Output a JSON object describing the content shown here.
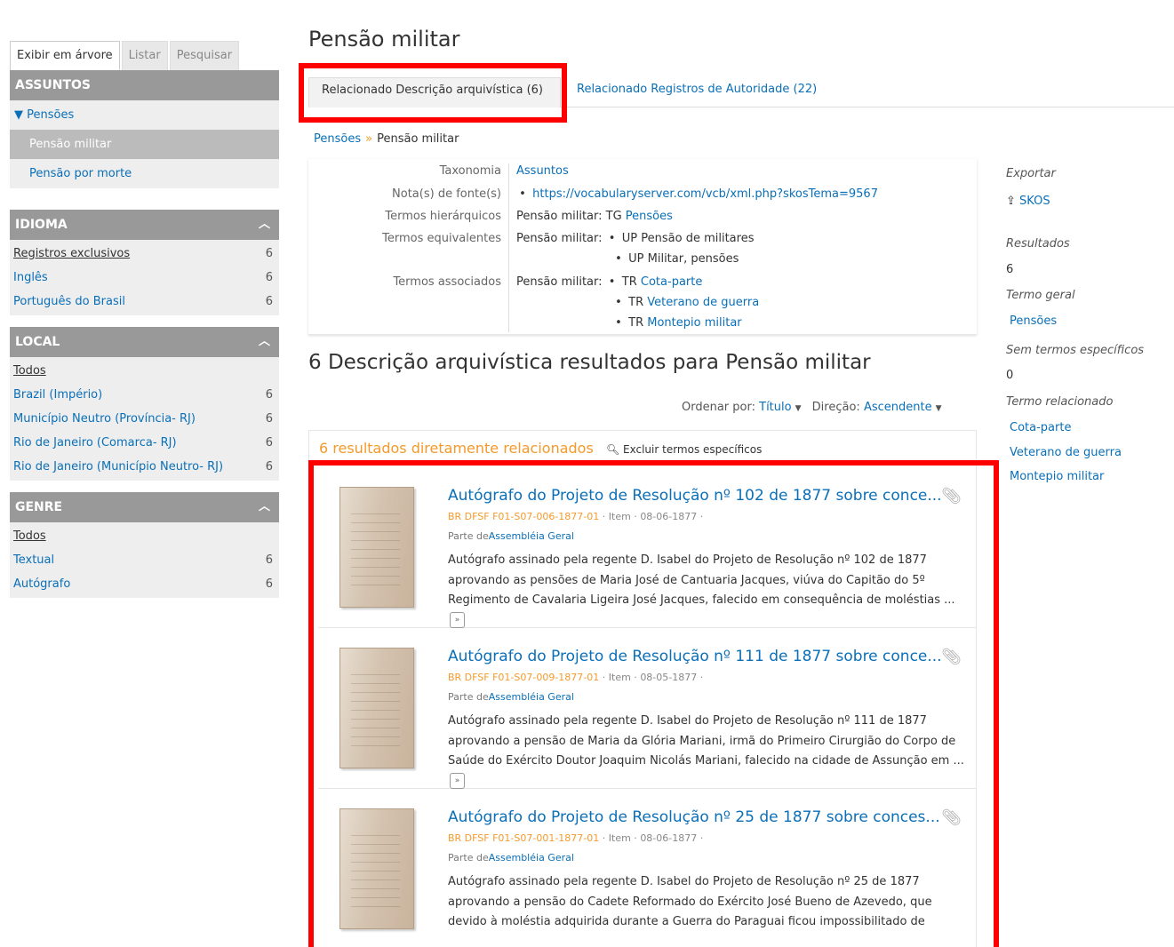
{
  "sidebar": {
    "tabs": [
      "Exibir em árvore",
      "Listar",
      "Pesquisar"
    ],
    "subjects": {
      "title": "ASSUNTOS",
      "items": [
        {
          "label": "▼ Pensões"
        },
        {
          "label": "Pensão militar"
        },
        {
          "label": "Pensão por morte"
        }
      ]
    },
    "language": {
      "title": "IDIOMA",
      "rows": [
        {
          "label": "Registros exclusivos",
          "count": "6"
        },
        {
          "label": "Inglês",
          "count": "6"
        },
        {
          "label": "Português do Brasil",
          "count": "6"
        }
      ]
    },
    "place": {
      "title": "LOCAL",
      "rows": [
        {
          "label": "Todos",
          "count": ""
        },
        {
          "label": "Brazil (Império)",
          "count": "6"
        },
        {
          "label": "Município Neutro (Província- RJ)",
          "count": "6"
        },
        {
          "label": "Rio de Janeiro (Comarca- RJ)",
          "count": "6"
        },
        {
          "label": "Rio de Janeiro (Município Neutro- RJ)",
          "count": "6"
        }
      ]
    },
    "genre": {
      "title": "GENRE",
      "rows": [
        {
          "label": "Todos",
          "count": ""
        },
        {
          "label": "Textual",
          "count": "6"
        },
        {
          "label": "Autógrafo",
          "count": "6"
        }
      ]
    }
  },
  "main": {
    "title": "Pensão militar",
    "tabs": [
      {
        "label": "Relacionado Descrição arquivística (6)"
      },
      {
        "label": "Relacionado Registros de Autoridade (22)"
      }
    ],
    "breadcrumb": {
      "parent": "Pensões",
      "sep": "»",
      "current": "Pensão militar"
    },
    "fields": {
      "taxonomy": {
        "label": "Taxonomia",
        "value": "Assuntos"
      },
      "source_notes": {
        "label": "Nota(s) de fonte(s)",
        "value": "https://vocabularyserver.com/vcb/xml.php?skosTema=9567"
      },
      "hierarchical": {
        "label": "Termos hierárquicos",
        "prefix": "Pensão militar: TG ",
        "value": "Pensões"
      },
      "equivalent": {
        "label": "Termos equivalentes",
        "prefix": "Pensão militar:",
        "values": [
          "UP Pensão de militares",
          "UP Militar, pensões"
        ]
      },
      "associated": {
        "label": "Termos associados",
        "prefix": "Pensão militar:",
        "tr": "TR",
        "values": [
          "Cota-parte",
          "Veterano de guerra",
          "Montepio militar"
        ]
      }
    },
    "results_title": "6 Descrição arquivística resultados para Pensão militar",
    "sort": {
      "label": "Ordenar por:",
      "value": "Título",
      "dir_label": "Direção:",
      "dir_value": "Ascendente"
    },
    "results_head": {
      "direct": "6 resultados diretamente relacionados",
      "exclude": "Excluir termos específicos"
    },
    "results": [
      {
        "title": "Autógrafo do Projeto de Resolução nº 102 de 1877 sobre conce...",
        "ref": "BR DFSF F01-S07-006-1877-01",
        "level": "Item",
        "date": "08-06-1877",
        "partof_label": "Parte de",
        "partof": "Assembléia Geral",
        "desc": "Autógrafo assinado pela regente D. Isabel do Projeto de Resolução nº 102 de 1877 aprovando as pensões de Maria José de Cantuaria Jacques, viúva do Capitão do 5º Regimento de Cavalaria Ligeira José Jacques, falecido em consequência de moléstias ..."
      },
      {
        "title": "Autógrafo do Projeto de Resolução nº 111 de 1877 sobre conce...",
        "ref": "BR DFSF F01-S07-009-1877-01",
        "level": "Item",
        "date": "08-05-1877",
        "partof_label": "Parte de",
        "partof": "Assembléia Geral",
        "desc": "Autógrafo assinado pela regente D. Isabel do Projeto de Resolução nº 111 de 1877 aprovando a pensão de Maria da Glória Mariani, irmã do Primeiro Cirurgião do Corpo de Saúde do Exército Doutor Joaquim Nicolás Mariani, falecido na cidade de Assunção em ..."
      },
      {
        "title": "Autógrafo do Projeto de Resolução nº 25 de 1877 sobre conces...",
        "ref": "BR DFSF F01-S07-001-1877-01",
        "level": "Item",
        "date": "08-06-1877",
        "partof_label": "Parte de",
        "partof": "Assembléia Geral",
        "desc": "Autógrafo assinado pela regente D. Isabel do Projeto de Resolução nº 25 de 1877 aprovando a pensão do Cadete Reformado do Exército José Bueno de Azevedo, que devido à moléstia adquirida durante a Guerra do Paraguai ficou impossibilitado de"
      }
    ]
  },
  "context": {
    "export_label": "Exportar",
    "export_link": "SKOS",
    "results_label": "Resultados",
    "results_count": "6",
    "broad_label": "Termo geral",
    "broad_value": "Pensões",
    "narrow_label": "Sem termos específicos",
    "narrow_count": "0",
    "related_label": "Termo relacionado",
    "related": [
      "Cota-parte",
      "Veterano de guerra",
      "Montepio militar"
    ]
  },
  "colors": {
    "highlight": "#ff0000",
    "link": "#0a6fb7",
    "accent": "#f49a2c",
    "panel_head": "#999999"
  }
}
